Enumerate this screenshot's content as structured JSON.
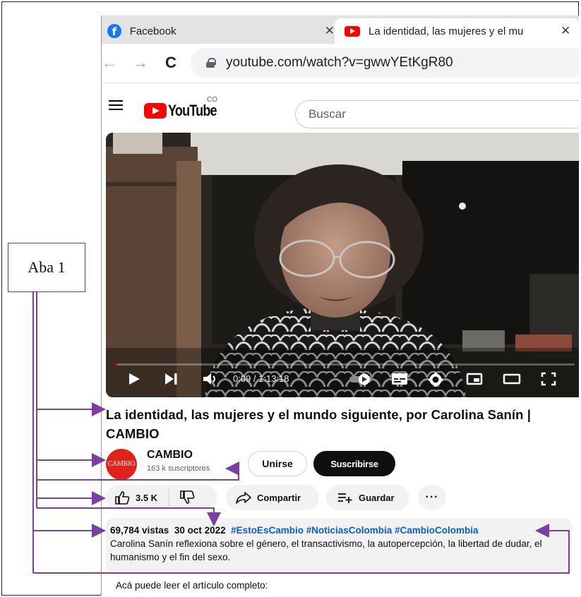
{
  "annotation": {
    "label": "Aba 1",
    "color": "#7a3fa0"
  },
  "browser": {
    "tabs": [
      {
        "title": "Facebook",
        "icon": "facebook-icon"
      },
      {
        "title": "La identidad, las mujeres y el mu",
        "icon": "youtube-icon"
      }
    ],
    "url": "youtube.com/watch?v=gwwYEtKgR80"
  },
  "youtube": {
    "logo_text": "YouTube",
    "logo_country": "CO",
    "search_placeholder": "Buscar"
  },
  "player": {
    "current_time": "0:09 / 1:13:18",
    "progress": 0.002
  },
  "video": {
    "title": "La identidad, las mujeres y el mundo siguiente, por Carolina Sanín | CAMBIO",
    "channel": {
      "name": "CAMBIO",
      "avatar_text": "CAMBIO",
      "subscribers": "163 k suscriptores"
    },
    "join_label": "Unirse",
    "subscribe_label": "Suscribirse",
    "likes": "3.5 K",
    "share_label": "Compartir",
    "save_label": "Guardar",
    "more_label": "···",
    "views": "69,784 vistas",
    "date": "30 oct 2022",
    "hashtags": "#EstoEsCambio #NoticiasColombia #CambioColombia",
    "description": "Carolina Sanín reflexiona sobre el género, el transactivismo, la autopercepción, la libertad de dudar, el humanismo y el fin del sexo.",
    "read_more": "Acá puede leer el artículo completo:"
  },
  "colors": {
    "youtube_red": "#ff0000",
    "facebook_blue": "#1877f2",
    "link_blue": "#065fd4"
  }
}
